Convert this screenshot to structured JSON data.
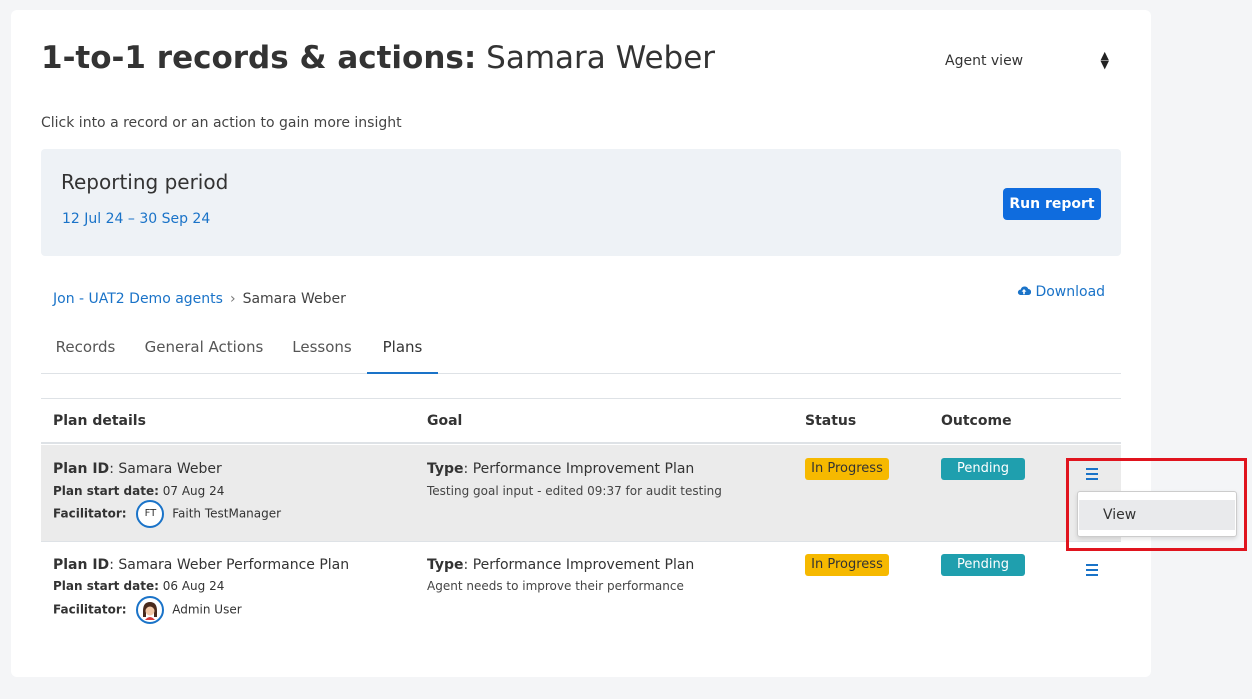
{
  "page": {
    "title_bold": "1-to-1 records & actions:",
    "title_name": "Samara Weber",
    "view_select": "Agent view",
    "subtitle": "Click into a record or an action to gain more insight"
  },
  "period": {
    "title": "Reporting period",
    "dates": "12 Jul 24 – 30 Sep 24",
    "run_label": "Run report"
  },
  "breadcrumb": {
    "parent": "Jon - UAT2 Demo agents",
    "separator": "›",
    "current": "Samara Weber"
  },
  "download_label": "Download",
  "tabs": [
    {
      "label": "Records"
    },
    {
      "label": "General Actions"
    },
    {
      "label": "Lessons"
    },
    {
      "label": "Plans",
      "active": true
    }
  ],
  "table": {
    "headers": [
      "Plan details",
      "Goal",
      "Status",
      "Outcome"
    ],
    "labels": {
      "plan_id": "Plan ID",
      "start_date": "Plan start date:",
      "facilitator": "Facilitator:",
      "type": "Type"
    },
    "rows": [
      {
        "plan_id": "Samara Weber",
        "start_date": "07 Aug 24",
        "facilitator_initials": "FT",
        "facilitator": "Faith TestManager",
        "type": "Performance Improvement Plan",
        "goal_note": "Testing goal input - edited 09:37 for audit testing",
        "status": "In Progress",
        "outcome": "Pending"
      },
      {
        "plan_id": "Samara Weber Performance Plan",
        "start_date": "06 Aug 24",
        "facilitator": "Admin User",
        "type": "Performance Improvement Plan",
        "goal_note": "Agent needs to improve their performance",
        "status": "In Progress",
        "outcome": "Pending"
      }
    ]
  },
  "dropdown": {
    "items": [
      "View"
    ]
  },
  "colors": {
    "accent": "#0f6cde",
    "link": "#1a73c8",
    "status_in_progress": "#f6b900",
    "outcome_pending": "#1f9fae",
    "highlight": "#e0141e"
  },
  "icons": {
    "download": "cloud-upload-icon",
    "row_menu": "hamburger-menu-icon",
    "select": "sort-arrows-icon"
  }
}
